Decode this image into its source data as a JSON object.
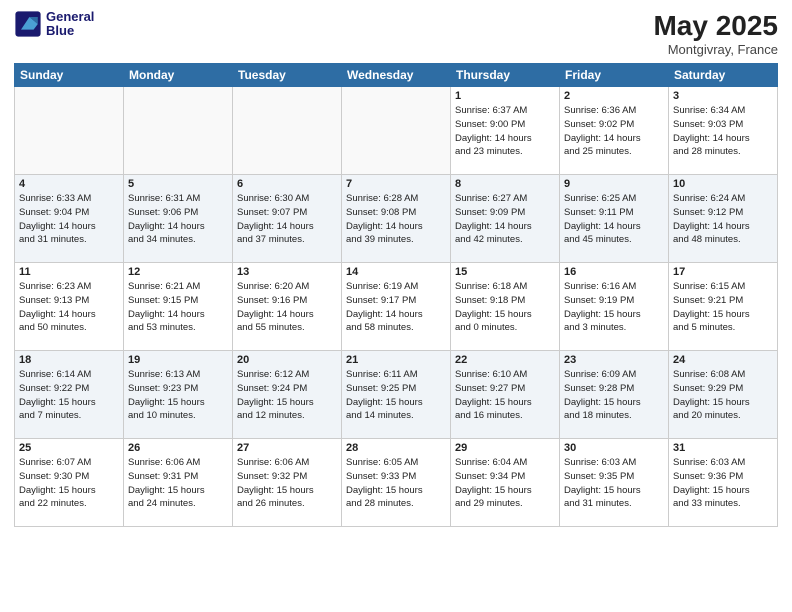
{
  "header": {
    "logo_line1": "General",
    "logo_line2": "Blue",
    "month_year": "May 2025",
    "location": "Montgivray, France"
  },
  "days_of_week": [
    "Sunday",
    "Monday",
    "Tuesday",
    "Wednesday",
    "Thursday",
    "Friday",
    "Saturday"
  ],
  "weeks": [
    [
      {
        "day": "",
        "info": ""
      },
      {
        "day": "",
        "info": ""
      },
      {
        "day": "",
        "info": ""
      },
      {
        "day": "",
        "info": ""
      },
      {
        "day": "1",
        "info": "Sunrise: 6:37 AM\nSunset: 9:00 PM\nDaylight: 14 hours\nand 23 minutes."
      },
      {
        "day": "2",
        "info": "Sunrise: 6:36 AM\nSunset: 9:02 PM\nDaylight: 14 hours\nand 25 minutes."
      },
      {
        "day": "3",
        "info": "Sunrise: 6:34 AM\nSunset: 9:03 PM\nDaylight: 14 hours\nand 28 minutes."
      }
    ],
    [
      {
        "day": "4",
        "info": "Sunrise: 6:33 AM\nSunset: 9:04 PM\nDaylight: 14 hours\nand 31 minutes."
      },
      {
        "day": "5",
        "info": "Sunrise: 6:31 AM\nSunset: 9:06 PM\nDaylight: 14 hours\nand 34 minutes."
      },
      {
        "day": "6",
        "info": "Sunrise: 6:30 AM\nSunset: 9:07 PM\nDaylight: 14 hours\nand 37 minutes."
      },
      {
        "day": "7",
        "info": "Sunrise: 6:28 AM\nSunset: 9:08 PM\nDaylight: 14 hours\nand 39 minutes."
      },
      {
        "day": "8",
        "info": "Sunrise: 6:27 AM\nSunset: 9:09 PM\nDaylight: 14 hours\nand 42 minutes."
      },
      {
        "day": "9",
        "info": "Sunrise: 6:25 AM\nSunset: 9:11 PM\nDaylight: 14 hours\nand 45 minutes."
      },
      {
        "day": "10",
        "info": "Sunrise: 6:24 AM\nSunset: 9:12 PM\nDaylight: 14 hours\nand 48 minutes."
      }
    ],
    [
      {
        "day": "11",
        "info": "Sunrise: 6:23 AM\nSunset: 9:13 PM\nDaylight: 14 hours\nand 50 minutes."
      },
      {
        "day": "12",
        "info": "Sunrise: 6:21 AM\nSunset: 9:15 PM\nDaylight: 14 hours\nand 53 minutes."
      },
      {
        "day": "13",
        "info": "Sunrise: 6:20 AM\nSunset: 9:16 PM\nDaylight: 14 hours\nand 55 minutes."
      },
      {
        "day": "14",
        "info": "Sunrise: 6:19 AM\nSunset: 9:17 PM\nDaylight: 14 hours\nand 58 minutes."
      },
      {
        "day": "15",
        "info": "Sunrise: 6:18 AM\nSunset: 9:18 PM\nDaylight: 15 hours\nand 0 minutes."
      },
      {
        "day": "16",
        "info": "Sunrise: 6:16 AM\nSunset: 9:19 PM\nDaylight: 15 hours\nand 3 minutes."
      },
      {
        "day": "17",
        "info": "Sunrise: 6:15 AM\nSunset: 9:21 PM\nDaylight: 15 hours\nand 5 minutes."
      }
    ],
    [
      {
        "day": "18",
        "info": "Sunrise: 6:14 AM\nSunset: 9:22 PM\nDaylight: 15 hours\nand 7 minutes."
      },
      {
        "day": "19",
        "info": "Sunrise: 6:13 AM\nSunset: 9:23 PM\nDaylight: 15 hours\nand 10 minutes."
      },
      {
        "day": "20",
        "info": "Sunrise: 6:12 AM\nSunset: 9:24 PM\nDaylight: 15 hours\nand 12 minutes."
      },
      {
        "day": "21",
        "info": "Sunrise: 6:11 AM\nSunset: 9:25 PM\nDaylight: 15 hours\nand 14 minutes."
      },
      {
        "day": "22",
        "info": "Sunrise: 6:10 AM\nSunset: 9:27 PM\nDaylight: 15 hours\nand 16 minutes."
      },
      {
        "day": "23",
        "info": "Sunrise: 6:09 AM\nSunset: 9:28 PM\nDaylight: 15 hours\nand 18 minutes."
      },
      {
        "day": "24",
        "info": "Sunrise: 6:08 AM\nSunset: 9:29 PM\nDaylight: 15 hours\nand 20 minutes."
      }
    ],
    [
      {
        "day": "25",
        "info": "Sunrise: 6:07 AM\nSunset: 9:30 PM\nDaylight: 15 hours\nand 22 minutes."
      },
      {
        "day": "26",
        "info": "Sunrise: 6:06 AM\nSunset: 9:31 PM\nDaylight: 15 hours\nand 24 minutes."
      },
      {
        "day": "27",
        "info": "Sunrise: 6:06 AM\nSunset: 9:32 PM\nDaylight: 15 hours\nand 26 minutes."
      },
      {
        "day": "28",
        "info": "Sunrise: 6:05 AM\nSunset: 9:33 PM\nDaylight: 15 hours\nand 28 minutes."
      },
      {
        "day": "29",
        "info": "Sunrise: 6:04 AM\nSunset: 9:34 PM\nDaylight: 15 hours\nand 29 minutes."
      },
      {
        "day": "30",
        "info": "Sunrise: 6:03 AM\nSunset: 9:35 PM\nDaylight: 15 hours\nand 31 minutes."
      },
      {
        "day": "31",
        "info": "Sunrise: 6:03 AM\nSunset: 9:36 PM\nDaylight: 15 hours\nand 33 minutes."
      }
    ]
  ]
}
